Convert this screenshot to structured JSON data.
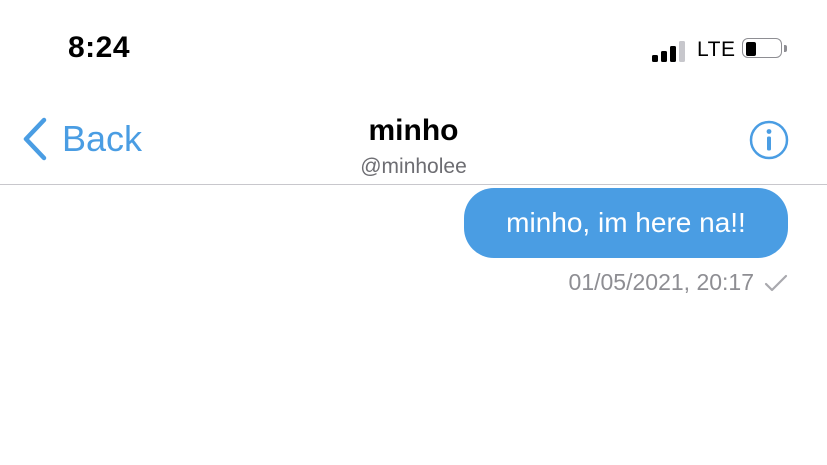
{
  "status_bar": {
    "time": "8:24",
    "network": "LTE",
    "signal_icon": "cellular-signal-icon",
    "battery_icon": "battery-icon"
  },
  "nav": {
    "back_label": "Back",
    "back_icon": "chevron-left-icon",
    "title": "minho",
    "subtitle": "@minholee",
    "info_icon": "info-icon"
  },
  "messages": [
    {
      "text": "minho, im here na!!",
      "timestamp": "01/05/2021, 20:17",
      "status_icon": "checkmark-icon",
      "direction": "outgoing"
    }
  ],
  "colors": {
    "accent": "#4a9de3",
    "meta_text": "#8e8e93",
    "divider": "#c8c7cc"
  }
}
